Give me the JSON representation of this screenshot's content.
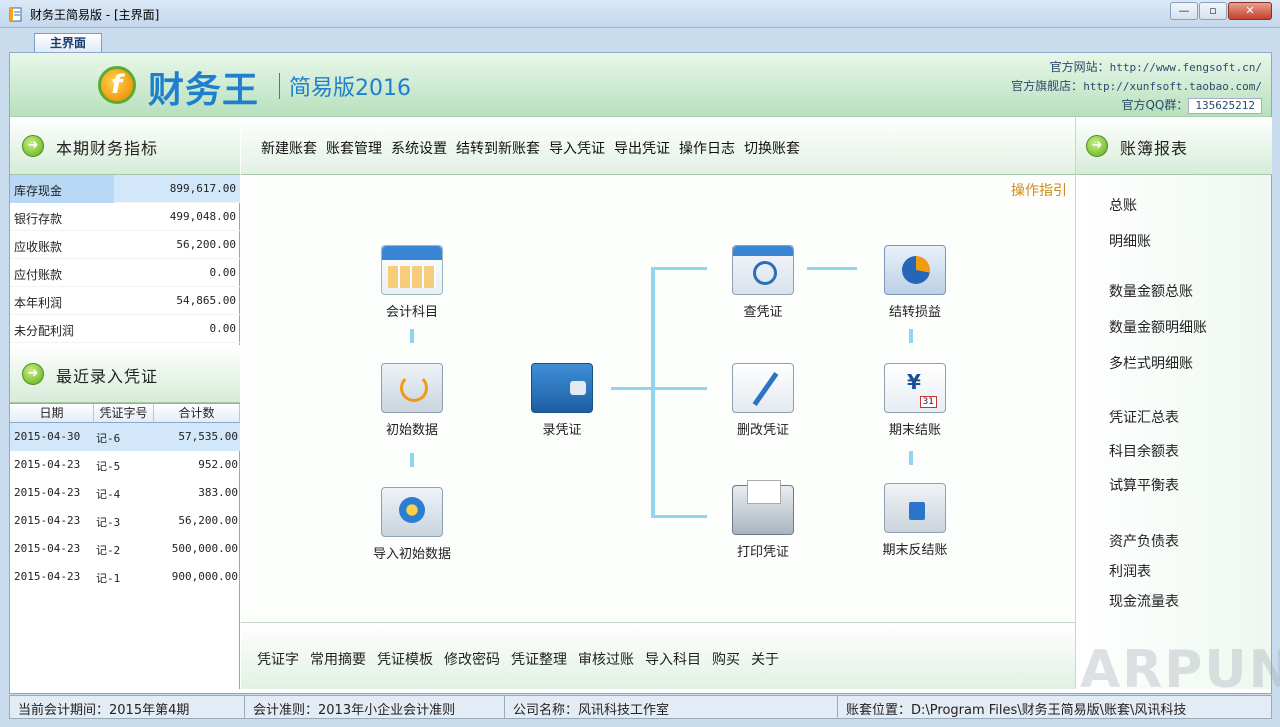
{
  "window": {
    "title": "财务王简易版 - [主界面]",
    "minimize": "—",
    "restore": "▫",
    "close": "✕",
    "icon": "ledger-app-icon"
  },
  "tabs": [
    {
      "label": "主界面"
    }
  ],
  "header": {
    "logo_letter": "f",
    "brand": "财务王",
    "edition": "简易版2016",
    "site_label": "官方网站：",
    "site_url": "http://www.fengsoft.cn/",
    "shop_label": "官方旗舰店：",
    "shop_url": "http://xunfsoft.taobao.com/",
    "qq_label": "官方QQ群：",
    "qq_value": "135625212"
  },
  "left": {
    "metrics_title": "本期财务指标",
    "metrics": [
      {
        "key": "库存现金",
        "value": "899,617.00"
      },
      {
        "key": "银行存款",
        "value": "499,048.00"
      },
      {
        "key": "应收账款",
        "value": "56,200.00"
      },
      {
        "key": "应付账款",
        "value": "0.00"
      },
      {
        "key": "本年利润",
        "value": "54,865.00"
      },
      {
        "key": "未分配利润",
        "value": "0.00"
      }
    ],
    "vouchers_title": "最近录入凭证",
    "voucher_columns": [
      "日期",
      "凭证字号",
      "合计数"
    ],
    "vouchers": [
      {
        "date": "2015-04-30",
        "no": "记-6",
        "total": "57,535.00"
      },
      {
        "date": "2015-04-23",
        "no": "记-5",
        "total": "952.00"
      },
      {
        "date": "2015-04-23",
        "no": "记-4",
        "total": "383.00"
      },
      {
        "date": "2015-04-23",
        "no": "记-3",
        "total": "56,200.00"
      },
      {
        "date": "2015-04-23",
        "no": "记-2",
        "total": "500,000.00"
      },
      {
        "date": "2015-04-23",
        "no": "记-1",
        "total": "900,000.00"
      }
    ]
  },
  "top_menu": [
    "新建账套",
    "账套管理",
    "系统设置",
    "结转到新账套",
    "导入凭证",
    "导出凭证",
    "操作日志",
    "切换账套"
  ],
  "guide": "操作指引",
  "flow": {
    "accounts": "会计科目",
    "init_data": "初始数据",
    "import_init": "导入初始数据",
    "record_voucher": "录凭证",
    "query_voucher": "查凭证",
    "edit_voucher": "删改凭证",
    "print_voucher": "打印凭证",
    "transfer_pl": "结转损益",
    "period_close": "期末结账",
    "period_reopen": "期末反结账"
  },
  "bottom_tools": [
    "凭证字",
    "常用摘要",
    "凭证模板",
    "修改密码",
    "凭证整理",
    "审核过账",
    "导入科目",
    "购买",
    "关于"
  ],
  "right": {
    "title": "账簿报表",
    "reports": [
      "总账",
      "明细账",
      "数量金额总账",
      "数量金额明细账",
      "多栏式明细账",
      "凭证汇总表",
      "科目余额表",
      "试算平衡表",
      "资产负债表",
      "利润表",
      "现金流量表"
    ]
  },
  "status": {
    "period": "当前会计期间：2015年第4期",
    "standard": "会计准则：2013年小企业会计准则",
    "company": "公司名称：风讯科技工作室",
    "location": "账套位置：D:\\Program Files\\财务王简易版\\账套\\风讯科技"
  },
  "watermark": "ARPUN"
}
